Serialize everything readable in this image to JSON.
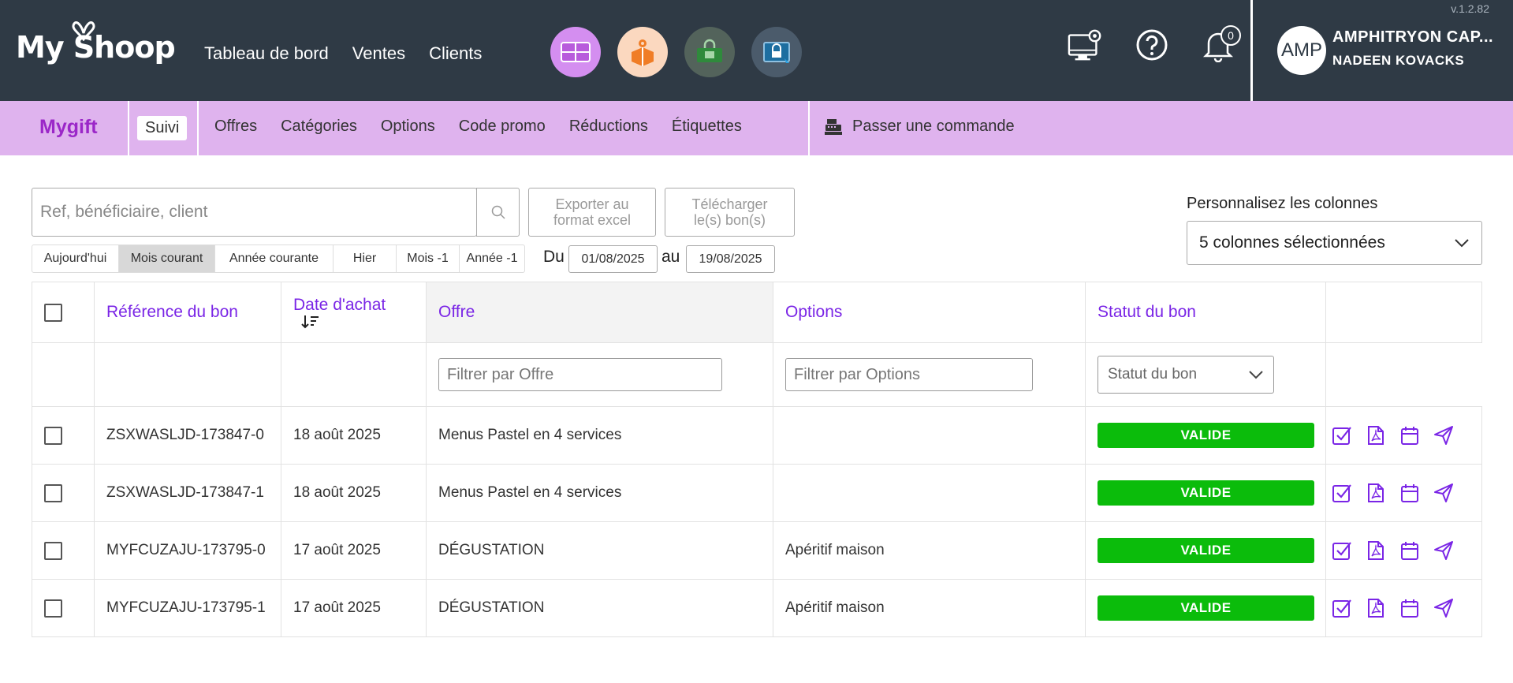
{
  "app": {
    "version": "v.1.2.82",
    "logo": "My Shoop",
    "nav": [
      "Tableau de bord",
      "Ventes",
      "Clients"
    ],
    "notifications_count": "0",
    "user": {
      "avatar": "AMP",
      "company": "AMPHITRYON CAP...",
      "name": "NADEEN KOVACKS"
    },
    "colors": {
      "topbar": "#2f3a45",
      "subbar": "#dfb3ee",
      "accent": "#7a25e6",
      "valid": "#0bbc0b"
    },
    "app_icons": [
      "gift-card-icon",
      "delivery-box-icon",
      "ticket-lock-icon",
      "screen-lock-icon"
    ],
    "right_icons": [
      "monitor-settings-icon",
      "help-icon",
      "bell-icon"
    ]
  },
  "subnav": {
    "title": "Mygift",
    "active_tab": "Suivi",
    "tabs": [
      "Offres",
      "Catégories",
      "Options",
      "Code promo",
      "Réductions",
      "Étiquettes"
    ],
    "order": "Passer une commande"
  },
  "toolbar": {
    "search_placeholder": "Ref, bénéficiaire, client",
    "export_l1": "Exporter au",
    "export_l2": "format excel",
    "download_l1": "Télécharger",
    "download_l2": "le(s) bon(s)",
    "columns_label": "Personnalisez les colonnes",
    "columns_value": "5 colonnes sélectionnées",
    "periods": [
      "Aujourd'hui",
      "Mois courant",
      "Année courante",
      "Hier",
      "Mois -1",
      "Année -1"
    ],
    "active_period": "Mois courant",
    "from_label": "Du",
    "from_date": "01/08/2025",
    "to_label": "au",
    "to_date": "19/08/2025"
  },
  "table": {
    "headers": {
      "ref": "Référence du bon",
      "date": "Date d'achat",
      "offer": "Offre",
      "options": "Options",
      "status": "Statut du bon"
    },
    "filters": {
      "offer": "Filtrer par Offre",
      "options": "Filtrer par Options",
      "status": "Statut du bon"
    },
    "rows": [
      {
        "ref": "ZSXWASLJD-173847-0",
        "date": "18 août 2025",
        "offer": "Menus Pastel en 4 services",
        "options": "",
        "status": "VALIDE"
      },
      {
        "ref": "ZSXWASLJD-173847-1",
        "date": "18 août 2025",
        "offer": "Menus Pastel en 4 services",
        "options": "",
        "status": "VALIDE"
      },
      {
        "ref": "MYFCUZAJU-173795-0",
        "date": "17 août 2025",
        "offer": "DÉGUSTATION",
        "options": "Apéritif maison",
        "status": "VALIDE"
      },
      {
        "ref": "MYFCUZAJU-173795-1",
        "date": "17 août 2025",
        "offer": "DÉGUSTATION",
        "options": "Apéritif maison",
        "status": "VALIDE"
      }
    ],
    "row_actions": [
      "validate-icon",
      "pdf-icon",
      "calendar-icon",
      "send-icon"
    ]
  }
}
